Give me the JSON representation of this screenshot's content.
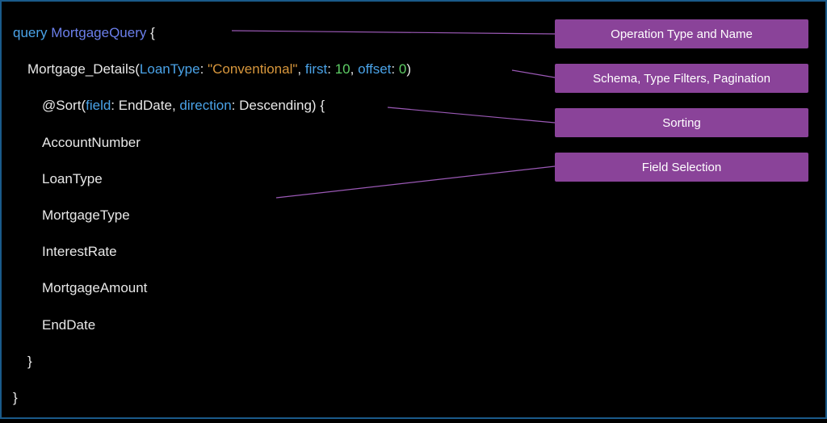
{
  "code": {
    "line1": {
      "keyword": "query",
      "name": "MortgageQuery",
      "brace": " {"
    },
    "line2": {
      "schema": "Mortgage_Details",
      "open": "(",
      "p1name": "LoanType",
      "p1colon": ":",
      "p1val": "\"Conventional\"",
      "sep1": ",",
      "p2name": "first",
      "p2colon": ":",
      "p2val": "10",
      "sep2": ",",
      "p3name": "offset",
      "p3colon": ":",
      "p3val": "0",
      "close": ")"
    },
    "line3": {
      "directive": "@Sort",
      "open": "(",
      "p1name": "field",
      "p1colon": ":",
      "p1val": "EndDate",
      "sep": ",",
      "p2name": "direction",
      "p2colon": ":",
      "p2val": "Descending",
      "close": ")",
      "brace": " {"
    },
    "fields": {
      "f1": "AccountNumber",
      "f2": "LoanType",
      "f3": "MortgageType",
      "f4": "InterestRate",
      "f5": "MortgageAmount",
      "f6": "EndDate"
    },
    "closeInner": "}",
    "closeOuter": "}"
  },
  "annotations": {
    "a1": "Operation Type and Name",
    "a2": "Schema, Type Filters, Pagination",
    "a3": "Sorting",
    "a4": "Field Selection"
  }
}
